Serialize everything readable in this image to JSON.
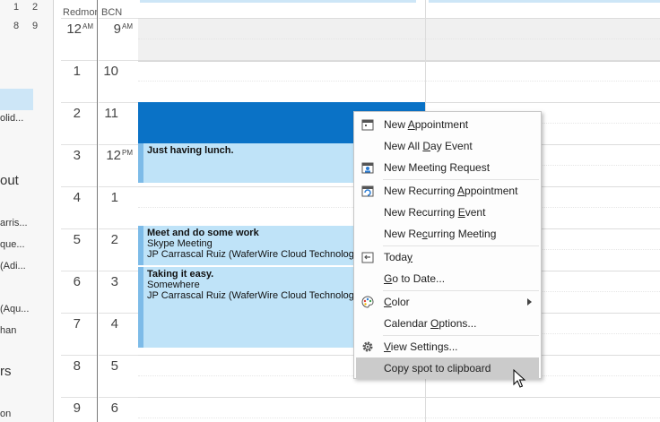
{
  "left_pane": {
    "mini_calendar_rows": [
      [
        "1",
        "2"
      ],
      [
        "8",
        "9"
      ]
    ],
    "fragments": [
      "olid...",
      "out",
      "arris...",
      "que...",
      "(Adi...",
      "(Aqu...",
      "han",
      "rs",
      "on"
    ]
  },
  "timezones": {
    "primary": "Redmond",
    "secondary": "BCN"
  },
  "hours": [
    {
      "primary": "12",
      "primary_suffix": "AM",
      "secondary": "9",
      "secondary_suffix": "AM"
    },
    {
      "primary": "1",
      "secondary": "10"
    },
    {
      "primary": "2",
      "secondary": "11"
    },
    {
      "primary": "3",
      "secondary": "12",
      "secondary_suffix": "PM"
    },
    {
      "primary": "4",
      "secondary": "1"
    },
    {
      "primary": "5",
      "secondary": "2"
    },
    {
      "primary": "6",
      "secondary": "3"
    },
    {
      "primary": "7",
      "secondary": "4"
    },
    {
      "primary": "8",
      "secondary": "5"
    },
    {
      "primary": "9",
      "secondary": "6"
    }
  ],
  "events": [
    {
      "title": "Just having lunch.",
      "lines": []
    },
    {
      "title": "Meet and do some work",
      "lines": [
        "Skype Meeting",
        "JP Carrascal Ruiz (WaferWire Cloud Technologies)"
      ]
    },
    {
      "title": "Taking it easy.",
      "lines": [
        "Somewhere",
        "JP Carrascal Ruiz (WaferWire Cloud Technologies)"
      ]
    }
  ],
  "context_menu": {
    "items": [
      {
        "label": "New Appointment",
        "key": "A",
        "icon": "appointment-icon"
      },
      {
        "label": "New All Day Event",
        "key": "D",
        "icon": ""
      },
      {
        "label": "New Meeting Request",
        "key": "Q",
        "icon": "meeting-request-icon"
      },
      {
        "label": "New Recurring Appointment",
        "key": "A",
        "icon": "recurring-appointment-icon"
      },
      {
        "label": "New Recurring Event",
        "key": "E",
        "icon": ""
      },
      {
        "label": "New Recurring Meeting",
        "key": "c",
        "icon": ""
      },
      {
        "label": "Today",
        "key": "y",
        "icon": "today-icon"
      },
      {
        "label": "Go to Date...",
        "key": "G",
        "icon": ""
      },
      {
        "label": "Color",
        "key": "C",
        "icon": "color-palette-icon",
        "submenu": true
      },
      {
        "label": "Calendar Options...",
        "key": "O",
        "icon": ""
      },
      {
        "label": "View Settings...",
        "key": "V",
        "icon": "gear-icon"
      },
      {
        "label": "Copy spot to clipboard",
        "key": "",
        "icon": "",
        "highlighted": true
      }
    ]
  },
  "colors": {
    "selection": "#0a72c6",
    "event_fill": "#bfe3f8",
    "event_bar": "#7dbbe8",
    "menu_highlight": "#cbcbcb"
  }
}
